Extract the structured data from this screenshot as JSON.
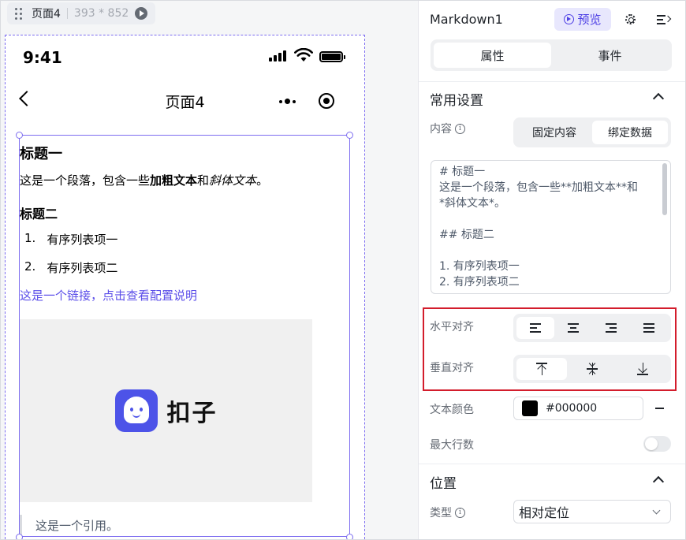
{
  "canvas": {
    "page_tag": {
      "name": "页面4",
      "size": "393 * 852",
      "icons": [
        "drag-handle-icon",
        "play-icon"
      ]
    },
    "phone": {
      "status_time": "9:41",
      "nav_title": "页面4",
      "icons": [
        "back-icon",
        "more-icon",
        "close-target-icon",
        "signal-icon",
        "wifi-icon",
        "battery-icon"
      ]
    },
    "markdown": {
      "h1": "标题一",
      "p1_prefix": "这是一个段落，包含一些",
      "p1_bold": "加粗文本",
      "p1_mid": "和",
      "p1_italic": "斜体文本",
      "p1_suffix": "。",
      "h2": "标题二",
      "list": [
        {
          "num": "1.",
          "text": "有序列表项一"
        },
        {
          "num": "2.",
          "text": "有序列表项二"
        }
      ],
      "link": "这是一个链接，点击查看配置说明",
      "logo_text": "扣子",
      "quote": "这是一个引用。"
    }
  },
  "panel": {
    "component_name": "Markdown1",
    "preview_label": "预览",
    "tabs": [
      {
        "label": "属性",
        "active": true
      },
      {
        "label": "事件",
        "active": false
      }
    ],
    "common": {
      "title": "常用设置",
      "content_label": "内容",
      "content_modes": [
        {
          "label": "固定内容",
          "active": false
        },
        {
          "label": "绑定数据",
          "active": true
        }
      ],
      "content_lines": [
        "# 标题一",
        "这是一个段落，包含一些**加粗文本**和",
        "*斜体文本*。",
        "",
        "## 标题二",
        "",
        "1. 有序列表项一",
        "2. 有序列表项二"
      ],
      "h_align_label": "水平对齐",
      "h_align_options": [
        "align-left-icon",
        "align-center-icon",
        "align-right-icon",
        "align-justify-icon"
      ],
      "h_align_selected": 0,
      "v_align_label": "垂直对齐",
      "v_align_options": [
        "align-top-icon",
        "align-middle-icon",
        "align-bottom-icon"
      ],
      "v_align_selected": 0,
      "text_color_label": "文本颜色",
      "text_color_value": "#000000",
      "max_lines_label": "最大行数",
      "max_lines_enabled": false
    },
    "position": {
      "title": "位置",
      "type_label": "类型",
      "type_value": "相对定位"
    }
  },
  "colors": {
    "accent": "#4e40e5",
    "selection": "#7d6df0",
    "link": "#5b4ee9",
    "highlight_box": "#d31d2c",
    "logo": "#4d53e8"
  }
}
